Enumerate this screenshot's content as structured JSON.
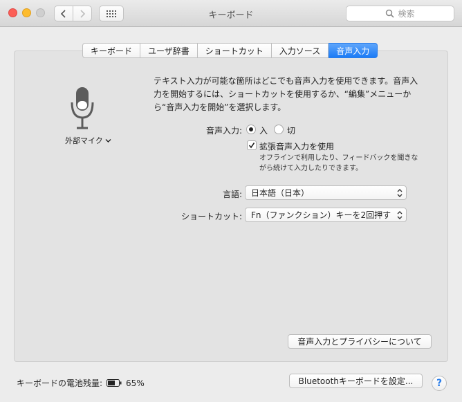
{
  "window": {
    "title": "キーボード"
  },
  "toolbar": {
    "search_placeholder": "検索"
  },
  "tabs": [
    {
      "label": "キーボード",
      "active": false
    },
    {
      "label": "ユーザ辞書",
      "active": false
    },
    {
      "label": "ショートカット",
      "active": false
    },
    {
      "label": "入力ソース",
      "active": false
    },
    {
      "label": "音声入力",
      "active": true
    }
  ],
  "mic": {
    "source_label": "外部マイク"
  },
  "dictation": {
    "description": "テキスト入力が可能な箇所はどこでも音声入力を使用できます。音声入力を開始するには、ショートカットを使用するか、“編集”メニューから“音声入力を開始”を選択します。",
    "label": "音声入力:",
    "option_on": "入",
    "option_off": "切",
    "selected": "入",
    "enhanced_label": "拡張音声入力を使用",
    "enhanced_checked": true,
    "enhanced_note": "オフラインで利用したり、フィードバックを聞きながら続けて入力したりできます。"
  },
  "language": {
    "label": "言語:",
    "value": "日本語（日本）"
  },
  "shortcut": {
    "label": "ショートカット:",
    "value": "Fn（ファンクション）キーを2回押す"
  },
  "privacy_button": "音声入力とプライバシーについて",
  "footer": {
    "battery_label": "キーボードの電池残量:",
    "battery_percent": "65%",
    "bluetooth_button": "Bluetoothキーボードを設定..."
  },
  "colors": {
    "accent": "#1b7bf6",
    "close": "#fc5f57",
    "minimize": "#fdbc2e"
  }
}
